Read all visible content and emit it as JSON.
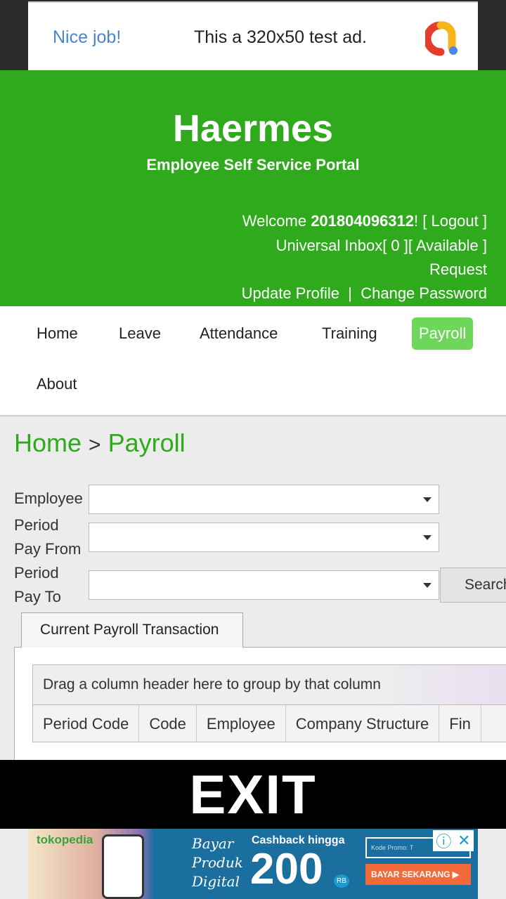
{
  "top_ad": {
    "headline": "Nice job!",
    "text": "This a 320x50 test ad.",
    "logo": "admob-logo-icon"
  },
  "header": {
    "title": "Haermes",
    "subtitle": "Employee Self Service Portal",
    "welcome_prefix": "Welcome ",
    "user_id": "201804096312",
    "welcome_suffix": "! ",
    "logout": "[ Logout ]",
    "inbox": "Universal Inbox[ 0 ]",
    "available_request": "[ Available ] Request",
    "available": "[ Available ]",
    "request": "Request",
    "update_profile": "Update Profile",
    "separator": "|",
    "change_password": "Change Password",
    "color": "#2eaa1c"
  },
  "nav": {
    "items": [
      {
        "label": "Home"
      },
      {
        "label": "Leave"
      },
      {
        "label": "Attendance"
      },
      {
        "label": "Training"
      },
      {
        "label": "Payroll",
        "active": true
      },
      {
        "label": "About"
      }
    ]
  },
  "breadcrumb": {
    "home": "Home",
    "sep": ">",
    "current": "Payroll"
  },
  "form": {
    "employee_label": "Employee",
    "employee_value": "",
    "period_from_label_1": "Period",
    "period_from_label_2": "Pay From",
    "period_from_value": "",
    "period_to_label_1": "Period",
    "period_to_label_2": "Pay To",
    "period_to_value": "",
    "search_label": "Search"
  },
  "tabs": [
    {
      "label": "Current Payroll Transaction",
      "active": true
    }
  ],
  "grid": {
    "group_hint": "Drag a column header here to group by that column",
    "columns": [
      "Period Code",
      "Code",
      "Employee",
      "Company Structure",
      "Fin"
    ]
  },
  "exit_label": "EXIT",
  "bottom_ad": {
    "brand": "tokopedia",
    "line1": "Bayar",
    "line2": "Produk",
    "line3": "Digital",
    "cashback": "Cashback hingga",
    "amount": "200",
    "unit": "RB",
    "promo": "Kode Promo: T",
    "cta": "BAYAR SEKARANG ▶",
    "info_icon": "info-icon",
    "close_icon": "close-icon"
  }
}
